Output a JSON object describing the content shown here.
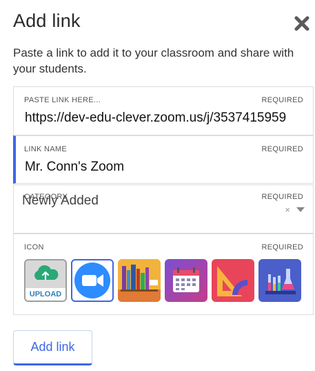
{
  "dialog": {
    "title": "Add link",
    "description": "Paste a link to add it to your classroom and share with your students."
  },
  "url_field": {
    "label": "PASTE LINK HERE...",
    "required": "REQUIRED",
    "value": "https://dev-edu-clever.zoom.us/j/3537415959"
  },
  "name_field": {
    "label": "LINK NAME",
    "required": "REQUIRED",
    "value": "Mr. Conn's Zoom"
  },
  "category_field": {
    "label": "CATEGORY",
    "required": "REQUIRED",
    "value": "Newly Added",
    "clear": "×"
  },
  "icon_field": {
    "label": "ICON",
    "required": "REQUIRED",
    "upload_label": "UPLOAD",
    "options": [
      "upload-icon",
      "zoom-icon",
      "library-books-icon",
      "calendar-icon",
      "math-tools-icon",
      "science-lab-icon"
    ],
    "selected": "zoom-icon"
  },
  "actions": {
    "submit_label": "Add link"
  },
  "colors": {
    "accent": "#3e67e6",
    "zoom_blue": "#2d8cff",
    "upload_green": "#2aa876"
  }
}
